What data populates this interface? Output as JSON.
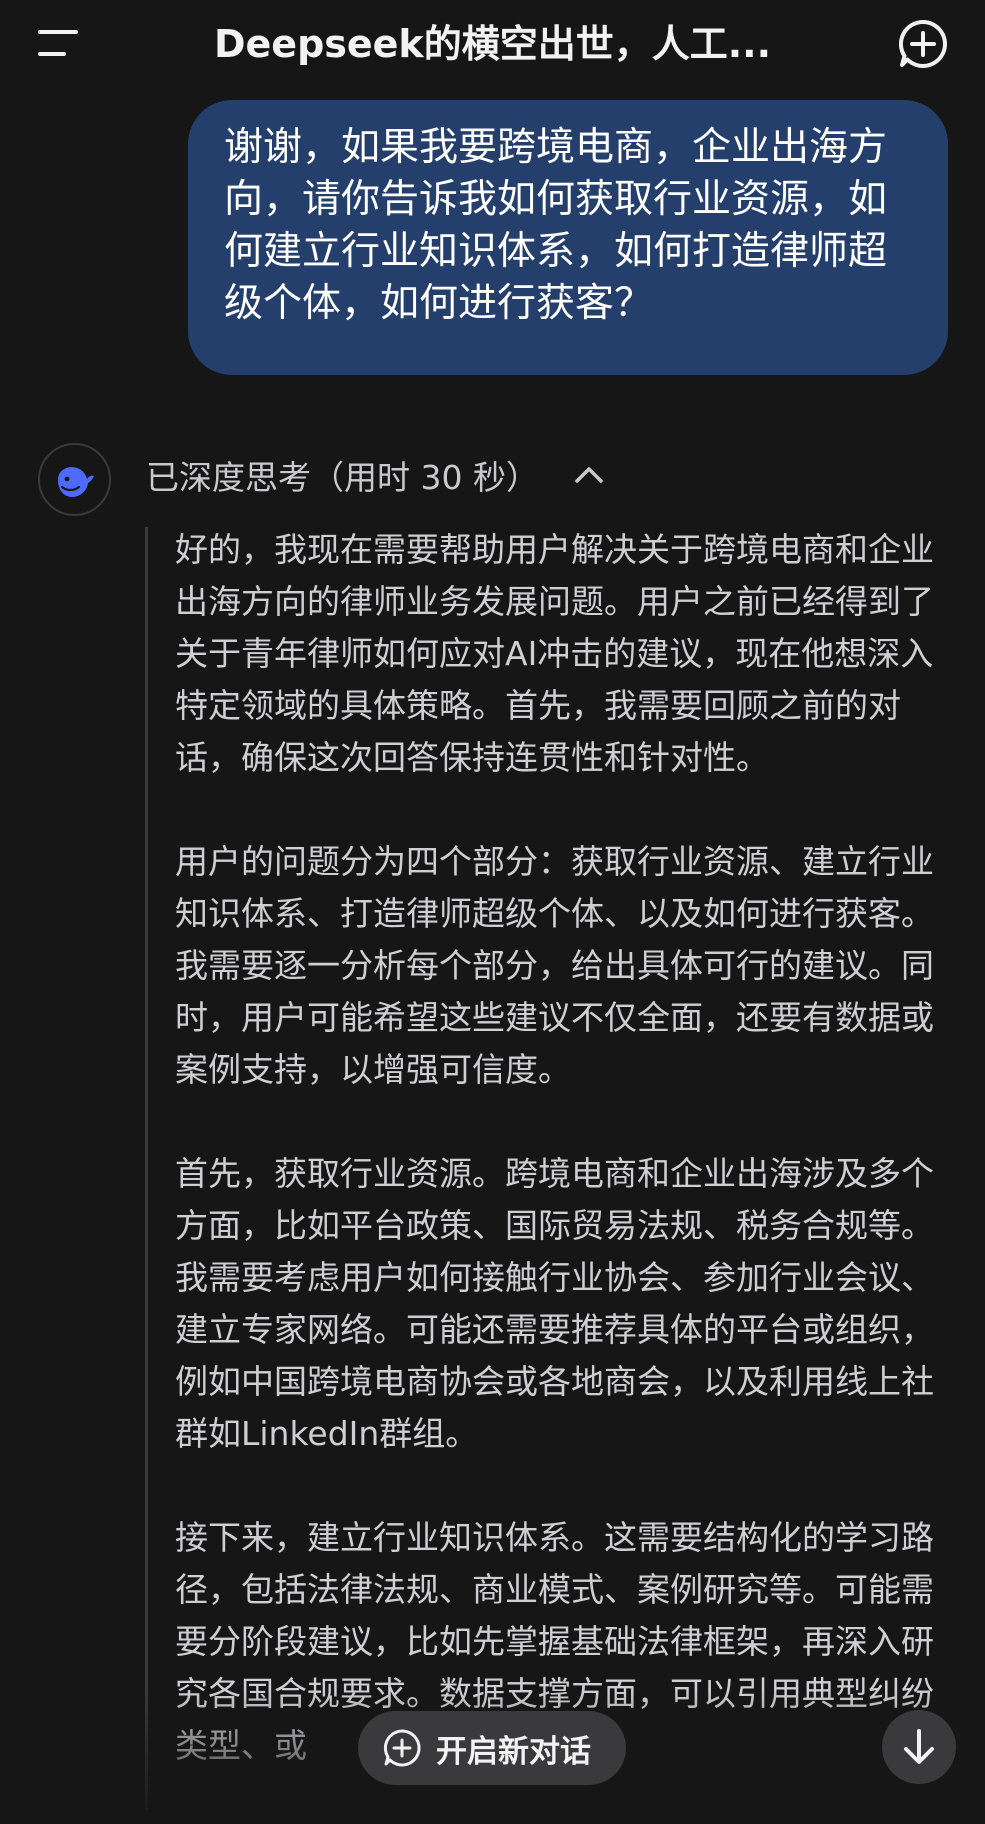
{
  "header": {
    "title": "Deepseek的横空出世，人工...",
    "menu_icon": "menu-icon",
    "new_chat_icon": "chat-plus-icon"
  },
  "user_message": {
    "text": "谢谢，如果我要跨境电商，企业出海方向，请你告诉我如何获取行业资源，如何建立行业知识体系，如何打造律师超级个体，如何进行获客？"
  },
  "assistant": {
    "avatar_icon": "deepseek-whale-icon",
    "thinking_label": "已深度思考（用时 30 秒）",
    "thinking_toggle_icon": "chevron-up-icon",
    "paragraphs": [
      "好的，我现在需要帮助用户解决关于跨境电商和企业出海方向的律师业务发展问题。用户之前已经得到了关于青年律师如何应对AI冲击的建议，现在他想深入特定领域的具体策略。首先，我需要回顾之前的对话，确保这次回答保持连贯性和针对性。",
      "用户的问题分为四个部分：获取行业资源、建立行业知识体系、打造律师超级个体、以及如何进行获客。我需要逐一分析每个部分，给出具体可行的建议。同时，用户可能希望这些建议不仅全面，还要有数据或案例支持，以增强可信度。",
      "首先，获取行业资源。跨境电商和企业出海涉及多个方面，比如平台政策、国际贸易法规、税务合规等。我需要考虑用户如何接触行业协会、参加行业会议、建立专家网络。可能还需要推荐具体的平台或组织，例如中国跨境电商协会或各地商会，以及利用线上社群如LinkedIn群组。",
      "接下来，建立行业知识体系。这需要结构化的学习路径，包括法律法规、商业模式、案例研究等。可能需要分阶段建议，比如先掌握基础法律框架，再深入研究各国合规要求。数据支撑方面，可以引用典型纠纷类型、或"
    ]
  },
  "bottom": {
    "new_chat_label": "开启新对话",
    "new_chat_icon": "plus-circle-icon",
    "scroll_icon": "arrow-down-icon"
  },
  "colors": {
    "background": "#161617",
    "user_bubble": "#243f6b",
    "thought_text": "#cfcfd1",
    "accent_blue": "#4d6bfe"
  }
}
